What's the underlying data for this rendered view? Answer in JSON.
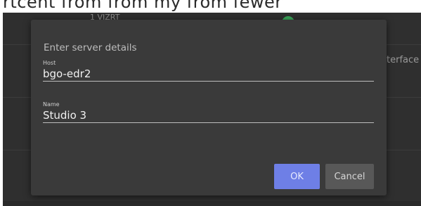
{
  "background": {
    "top_strip_text": "rtcent from from my from fewer",
    "row_label": "1 VIZRT",
    "side_text": "terface is",
    "status_color": "#3aa65a"
  },
  "dialog": {
    "title": "Enter server details",
    "host": {
      "label": "Host",
      "value": "bgo-edr2"
    },
    "name": {
      "label": "Name",
      "value": "Studio 3"
    },
    "ok_label": "OK",
    "cancel_label": "Cancel",
    "accent_color": "#6e7fe6"
  }
}
